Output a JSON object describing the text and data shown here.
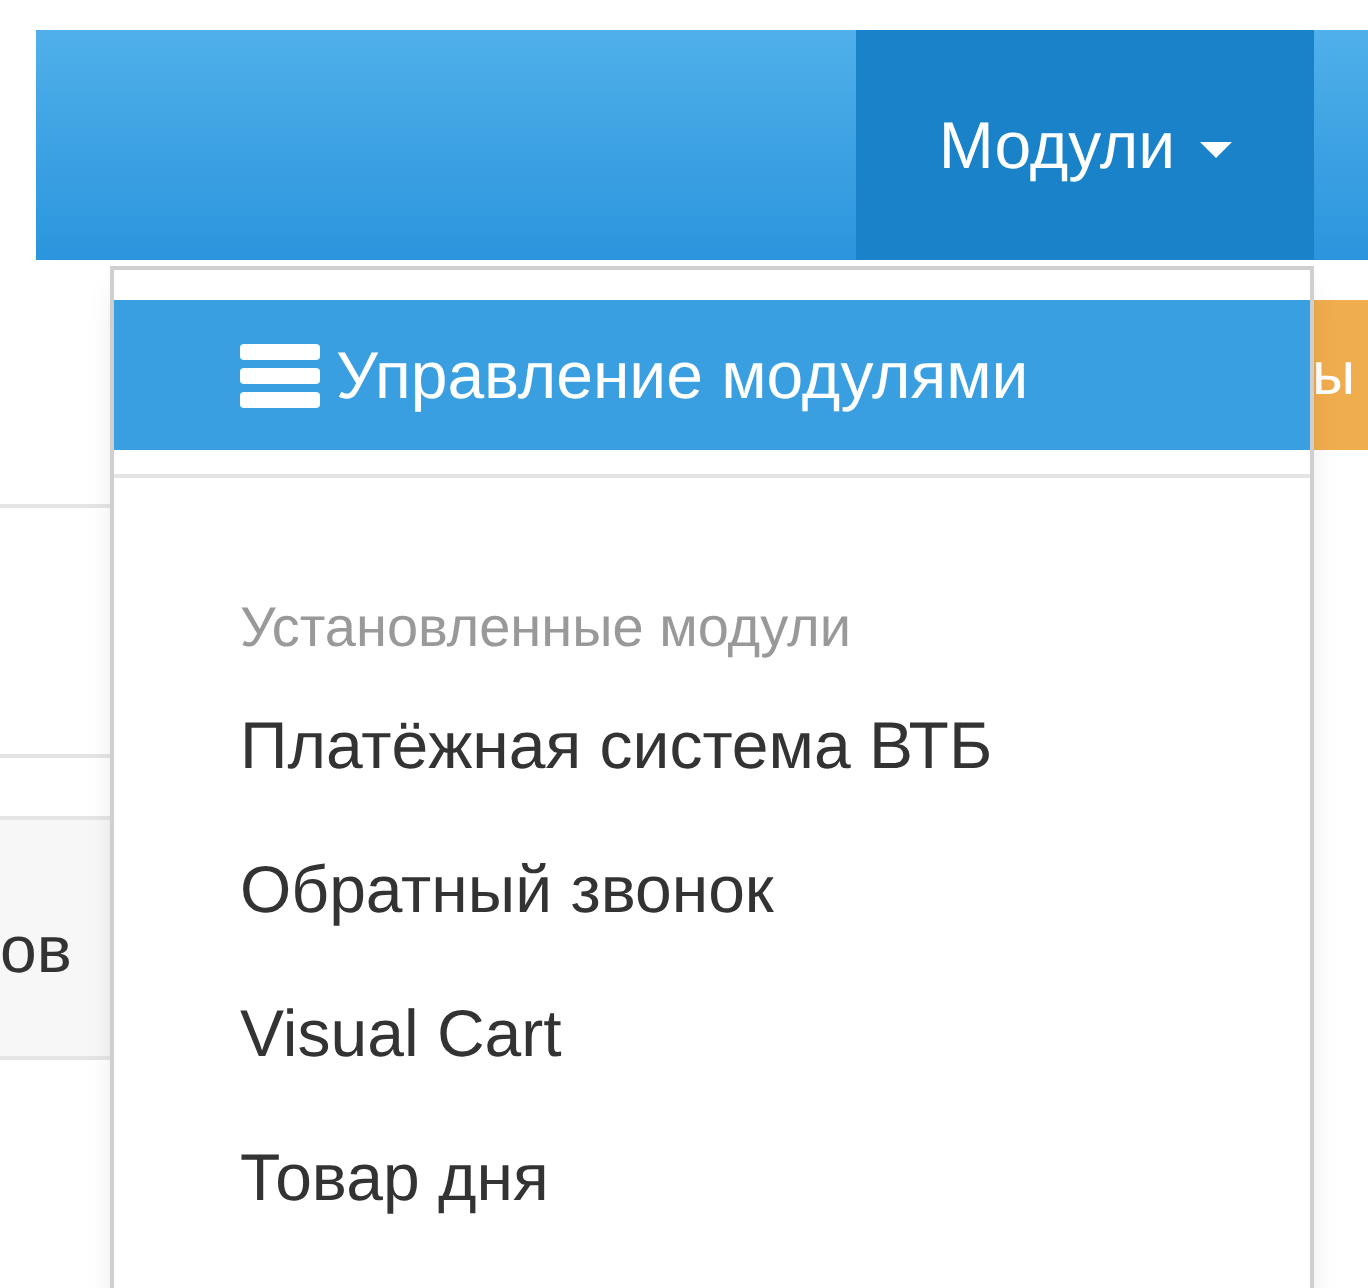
{
  "navbar": {
    "menu": {
      "label": "Модули",
      "expanded": true
    }
  },
  "dropdown": {
    "items": [
      {
        "kind": "action",
        "label": "Управление модулями",
        "selected": true
      },
      {
        "kind": "divider"
      },
      {
        "kind": "header",
        "label": "Установленные модули"
      },
      {
        "kind": "link",
        "label": "Платёжная система ВТБ",
        "selected": false
      },
      {
        "kind": "link",
        "label": "Обратный звонок",
        "selected": false
      },
      {
        "kind": "link",
        "label": "Visual Cart",
        "selected": false
      },
      {
        "kind": "link",
        "label": "Товар дня",
        "selected": false
      }
    ]
  },
  "background": {
    "row_text": "ов",
    "button_text": "ы"
  }
}
